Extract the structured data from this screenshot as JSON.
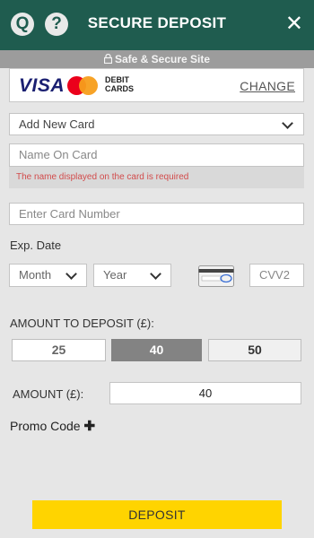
{
  "header": {
    "title": "SECURE DEPOSIT",
    "support_icon_glyph": "Q",
    "help_icon_glyph": "?",
    "close_glyph": "✕",
    "color": "#1f5c4f"
  },
  "secure_bar": {
    "text": "Safe & Secure Site"
  },
  "payment_method": {
    "visa_label": "VISA",
    "debit_line1": "DEBIT",
    "debit_line2": "CARDS",
    "change_label": "CHANGE"
  },
  "card_select": {
    "value": "Add New Card"
  },
  "name_on_card": {
    "placeholder": "Name On Card",
    "error": "The name displayed on the card is required",
    "error_color": "#d24b4b"
  },
  "card_number": {
    "placeholder": "Enter Card Number"
  },
  "expiry": {
    "label": "Exp. Date",
    "month_value": "Month",
    "year_value": "Year"
  },
  "cvv": {
    "placeholder": "CVV2"
  },
  "amount_quick": {
    "label": "AMOUNT TO DEPOSIT (£):",
    "options": [
      "25",
      "40",
      "50"
    ],
    "selected": "40"
  },
  "amount_field": {
    "label": "AMOUNT (£):",
    "value": "40"
  },
  "promo": {
    "label": "Promo Code",
    "icon_glyph": "✚"
  },
  "deposit_button": {
    "label": "DEPOSIT",
    "color": "#ffd400"
  }
}
